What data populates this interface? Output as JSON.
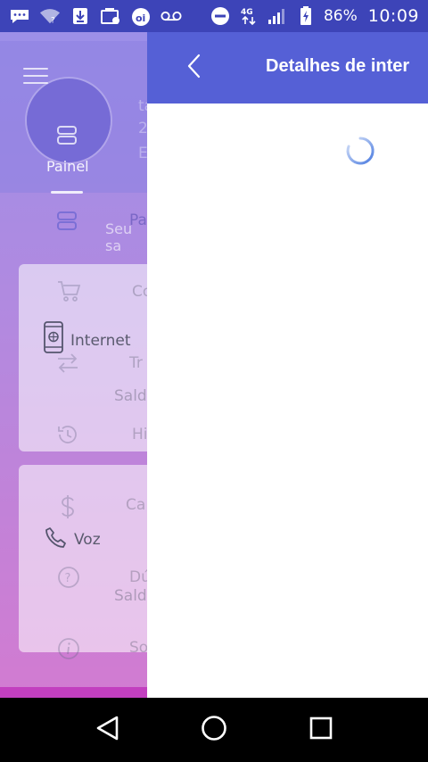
{
  "status_bar": {
    "icons_left": [
      "chat-bubble-icon",
      "wifi-question-icon",
      "download-icon",
      "store-icon",
      "operator-oi-icon",
      "voicemail-icon"
    ],
    "icons_right": [
      "do-not-disturb-icon",
      "network-4g-icon",
      "signal-icon",
      "battery-charging-icon"
    ],
    "battery": "86%",
    "time": "10:09",
    "colors": {
      "background": "#3d44b8"
    }
  },
  "background_app": {
    "tab_label": "Painel",
    "partial_text": [
      "ta",
      "2",
      "E",
      "Pa",
      "Seu sa",
      "Co",
      "Tr",
      "Saldo",
      "Hi",
      "Ca",
      "Dú",
      "Saldo",
      "So"
    ],
    "cards": [
      {
        "label": "Internet",
        "icon": "phone-globe-icon"
      },
      {
        "label": "Voz",
        "icon": "phone-handset-icon"
      }
    ],
    "colors": {
      "gradient_top": "#9c8fe8",
      "gradient_bottom": "#d27bd1"
    }
  },
  "panel": {
    "title": "Detalhes de inter",
    "back_icon": "chevron-left-icon",
    "loading_icon": "loading-spinner-icon",
    "colors": {
      "header": "#5560d6",
      "body": "#ffffff",
      "spinner": "#4a7be0"
    }
  },
  "nav_bar": {
    "buttons": [
      "back-triangle-icon",
      "home-circle-icon",
      "recents-square-icon"
    ]
  }
}
